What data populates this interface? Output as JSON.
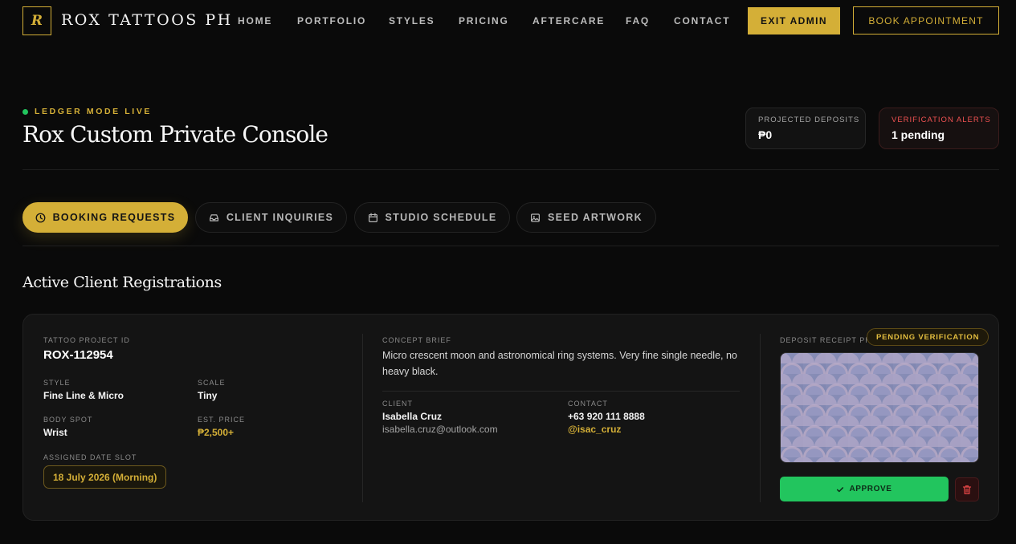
{
  "nav": {
    "logo_letter": "R",
    "brand": "ROX TATTOOS PH",
    "links": [
      "HOME",
      "PORTFOLIO",
      "STYLES",
      "PRICING",
      "AFTERCARE",
      "FAQ",
      "CONTACT"
    ],
    "exit_admin": "EXIT ADMIN",
    "book_appointment": "BOOK APPOINTMENT"
  },
  "header": {
    "status": "LEDGER MODE LIVE",
    "title": "Rox Custom Private Console",
    "stats": [
      {
        "label": "PROJECTED DEPOSITS",
        "value": "₱0"
      },
      {
        "label": "VERIFICATION ALERTS",
        "value": "1 pending"
      }
    ]
  },
  "tabs": [
    "BOOKING REQUESTS",
    "CLIENT INQUIRIES",
    "STUDIO SCHEDULE",
    "SEED ARTWORK"
  ],
  "section_title": "Active Client Registrations",
  "booking": {
    "project_id_label": "TATTOO PROJECT ID",
    "project_id": "ROX-112954",
    "style_label": "STYLE",
    "style": "Fine Line & Micro",
    "scale_label": "SCALE",
    "scale": "Tiny",
    "body_spot_label": "BODY SPOT",
    "body_spot": "Wrist",
    "price_label": "EST. PRICE",
    "price": "₱2,500+",
    "date_label": "ASSIGNED DATE SLOT",
    "date": "18 July 2026 (Morning)",
    "brief_label": "CONCEPT BRIEF",
    "brief": "Micro crescent moon and astronomical ring systems. Very fine single needle, no heavy black.",
    "client_label": "CLIENT",
    "client_name": "Isabella Cruz",
    "client_email": "isabella.cruz@outlook.com",
    "contact_label": "CONTACT",
    "contact_phone": "+63 920 111 8888",
    "contact_handle": "@isac_cruz",
    "receipt_label": "DEPOSIT RECEIPT PROOF",
    "status_badge": "PENDING VERIFICATION",
    "approve_label": "APPROVE"
  },
  "colors": {
    "accent": "#d4af37",
    "success": "#22c55e",
    "danger": "#f05252",
    "background": "#0a0a0a"
  }
}
